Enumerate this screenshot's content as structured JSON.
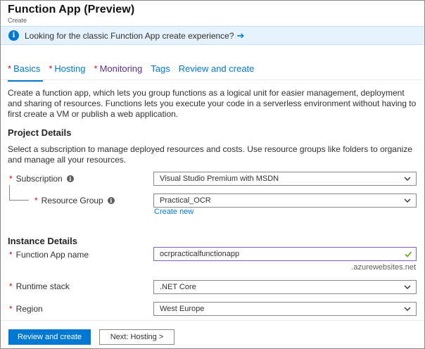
{
  "header": {
    "title": "Function App (Preview)",
    "subtitle": "Create"
  },
  "banner": {
    "text": "Looking for the classic Function App create experience?",
    "arrow": "➔"
  },
  "tabs": [
    {
      "label": "Basics",
      "required": "*"
    },
    {
      "label": "Hosting",
      "required": "*"
    },
    {
      "label": "Monitoring",
      "required": "*"
    },
    {
      "label": "Tags"
    },
    {
      "label": "Review and create"
    }
  ],
  "intro": "Create a function app, which lets you group functions as a logical unit for easier management, deployment and sharing of resources. Functions lets you execute your code in a serverless environment without having to first create a VM or publish a web application.",
  "project": {
    "heading": "Project Details",
    "description": "Select a subscription to manage deployed resources and costs. Use resource groups like folders to organize and manage all your resources.",
    "subscription": {
      "required": "*",
      "label": "Subscription",
      "value": "Visual Studio Premium with MSDN"
    },
    "resource_group": {
      "required": "*",
      "label": "Resource Group",
      "value": "Practical_OCR",
      "create_new": "Create new"
    }
  },
  "instance": {
    "heading": "Instance Details",
    "app_name": {
      "required": "*",
      "label": "Function App name",
      "value": "ocrpracticalfunctionapp",
      "suffix": ".azurewebsites.net"
    },
    "runtime": {
      "required": "*",
      "label": "Runtime stack",
      "value": ".NET Core"
    },
    "region": {
      "required": "*",
      "label": "Region",
      "value": "West Europe"
    }
  },
  "footer": {
    "primary": "Review and create",
    "secondary": "Next: Hosting >"
  },
  "colors": {
    "accent": "#0078d4",
    "required": "#c50f1f",
    "banner_bg": "#e6f2fb",
    "valid": "#57a300"
  }
}
